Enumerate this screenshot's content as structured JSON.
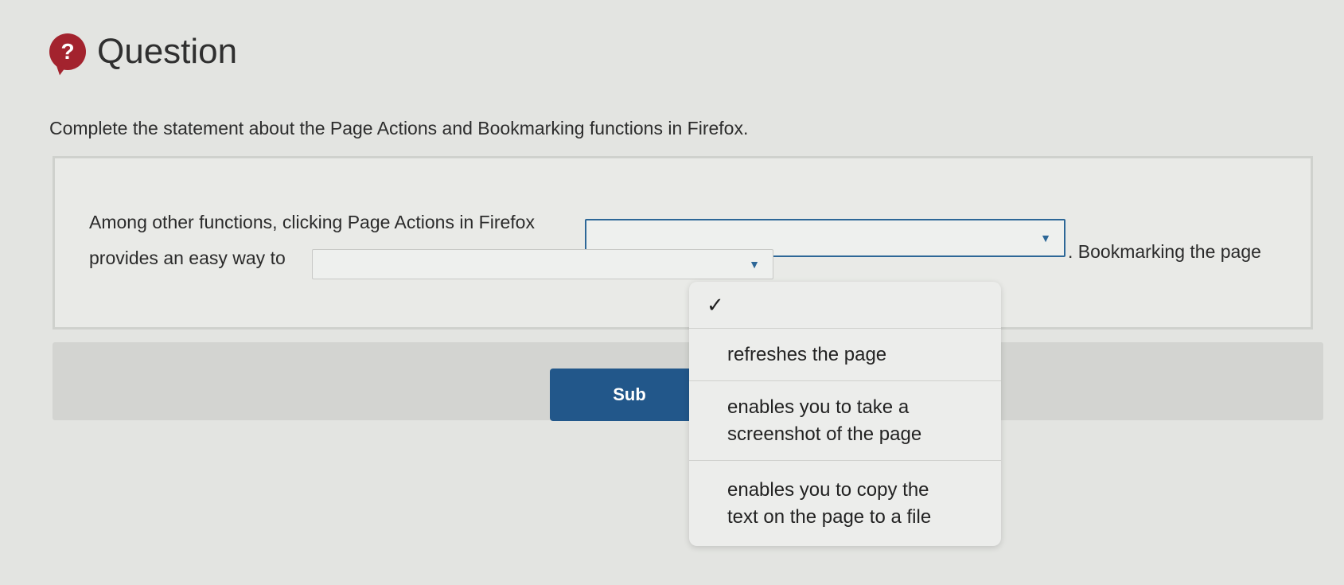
{
  "header": {
    "icon": "?",
    "title": "Question"
  },
  "prompt": "Complete the statement about the Page Actions and Bookmarking functions in Firefox.",
  "statement": {
    "part1": "Among other functions, clicking Page Actions in Firefox",
    "part2": ". Bookmarking the page",
    "part3": "provides an easy way to"
  },
  "submit": {
    "label": "Sub"
  },
  "dropdown": {
    "check": "✓",
    "options": [
      {
        "label": ""
      },
      {
        "label": "refreshes the page"
      },
      {
        "label": "enables you to take a screenshot of the page"
      },
      {
        "label": "enables you to copy the text on the page to a file"
      }
    ]
  }
}
